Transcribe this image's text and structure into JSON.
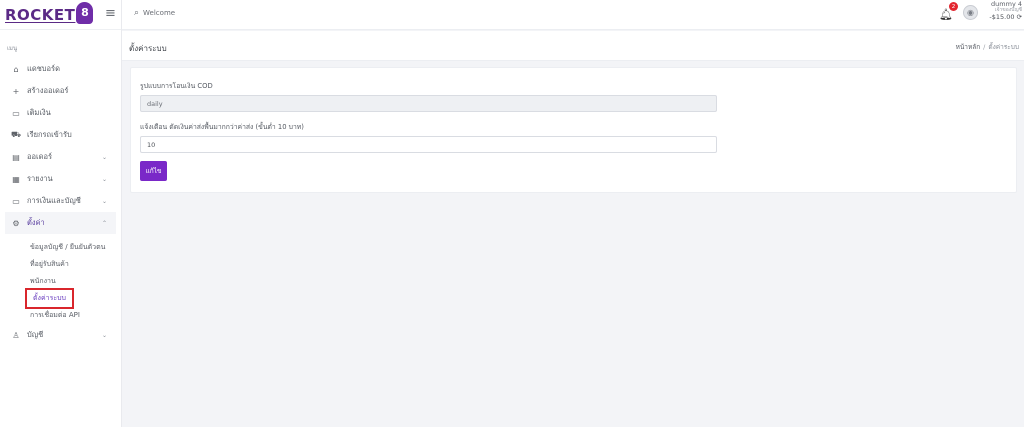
{
  "brand": {
    "name": "ROCKET",
    "badge": "8"
  },
  "sidebar": {
    "heading": "เมนู",
    "items": [
      {
        "icon": "⌂",
        "label": "แดชบอร์ด"
      },
      {
        "icon": "+",
        "label": "สร้างออเดอร์"
      },
      {
        "icon": "▭",
        "label": "เติมเงิน"
      },
      {
        "icon": "⛟",
        "label": "เรียกรถเข้ารับ"
      },
      {
        "icon": "▤",
        "label": "ออเดอร์",
        "chevron": "⌄"
      },
      {
        "icon": "▦",
        "label": "รายงาน",
        "chevron": "⌄"
      },
      {
        "icon": "▭",
        "label": "การเงินและบัญชี",
        "chevron": "⌄"
      },
      {
        "icon": "⚙",
        "label": "ตั้งค่า",
        "chevron": "⌃"
      }
    ],
    "submenu": [
      "ข้อมูลบัญชี / ยืนยันตัวตน",
      "ที่อยู่รับสินค้า",
      "พนักงาน",
      "ตั้งค่าระบบ",
      "การเชื่อมต่อ API"
    ],
    "account": {
      "icon": "♙",
      "label": "บัญชี",
      "chevron": "⌄"
    }
  },
  "header": {
    "search_text": "Welcome",
    "notification_count": "2",
    "user_name": "dummy 4",
    "user_role": "เจ้าของบัญชี",
    "balance": "-$15.00 ⟳"
  },
  "page": {
    "title": "ตั้งค่าระบบ",
    "breadcrumb_home": "หน้าหลัก",
    "breadcrumb_sep": "/",
    "breadcrumb_current": "ตั้งค่าระบบ"
  },
  "form": {
    "cod_label": "รูปแบบการโอนเงิน COD",
    "cod_value": "daily",
    "alert_label": "แจ้งเตือน ตัดเงินค่าส่งพื้นมากกว่าค่าส่ง (ขั้นต่ำ 10 บาท)",
    "alert_value": "10",
    "edit_button": "แก้ไข"
  },
  "colors": {
    "accent": "#7a28c8",
    "brand": "#5b2a86",
    "highlight_box": "#d9262c",
    "badge": "#e3262f"
  }
}
